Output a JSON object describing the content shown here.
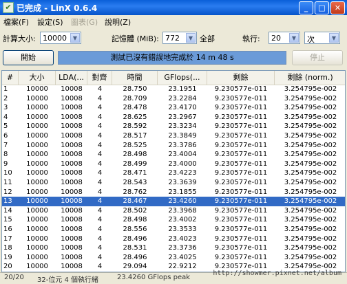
{
  "window": {
    "title": "已完成 - LinX 0.6.4",
    "minimize": "_",
    "maximize": "□",
    "close": "✕",
    "app_icon": "check-icon"
  },
  "menu": [
    {
      "label": "檔案(F)",
      "enabled": true
    },
    {
      "label": "設定(S)",
      "enabled": true
    },
    {
      "label": "圖表(G)",
      "enabled": false
    },
    {
      "label": "說明(Z)",
      "enabled": true
    }
  ],
  "controls": {
    "problem_size_label": "計算大小:",
    "problem_size_value": "10000",
    "memory_label": "記憶體 (MiB):",
    "memory_value": "772",
    "all_label": "全部",
    "run_label": "執行:",
    "run_value": "20",
    "run_unit": "次",
    "start_button": "開始",
    "stop_button": "停止",
    "status_text": "測試已沒有錯誤地完成於 14 m 48 s"
  },
  "table": {
    "columns": [
      "#",
      "大小",
      "LDA(...",
      "對齊",
      "時間",
      "GFlops(...",
      "剩餘",
      "剩餘 (norm.)"
    ],
    "selected_row": 13,
    "rows": [
      [
        "1",
        "10000",
        "10008",
        "4",
        "28.750",
        "23.1951",
        "9.230577e-011",
        "3.254795e-002"
      ],
      [
        "2",
        "10000",
        "10008",
        "4",
        "28.709",
        "23.2284",
        "9.230577e-011",
        "3.254795e-002"
      ],
      [
        "3",
        "10000",
        "10008",
        "4",
        "28.478",
        "23.4170",
        "9.230577e-011",
        "3.254795e-002"
      ],
      [
        "4",
        "10000",
        "10008",
        "4",
        "28.625",
        "23.2967",
        "9.230577e-011",
        "3.254795e-002"
      ],
      [
        "5",
        "10000",
        "10008",
        "4",
        "28.592",
        "23.3234",
        "9.230577e-011",
        "3.254795e-002"
      ],
      [
        "6",
        "10000",
        "10008",
        "4",
        "28.517",
        "23.3849",
        "9.230577e-011",
        "3.254795e-002"
      ],
      [
        "7",
        "10000",
        "10008",
        "4",
        "28.525",
        "23.3786",
        "9.230577e-011",
        "3.254795e-002"
      ],
      [
        "8",
        "10000",
        "10008",
        "4",
        "28.498",
        "23.4004",
        "9.230577e-011",
        "3.254795e-002"
      ],
      [
        "9",
        "10000",
        "10008",
        "4",
        "28.499",
        "23.4000",
        "9.230577e-011",
        "3.254795e-002"
      ],
      [
        "10",
        "10000",
        "10008",
        "4",
        "28.471",
        "23.4223",
        "9.230577e-011",
        "3.254795e-002"
      ],
      [
        "11",
        "10000",
        "10008",
        "4",
        "28.543",
        "23.3639",
        "9.230577e-011",
        "3.254795e-002"
      ],
      [
        "12",
        "10000",
        "10008",
        "4",
        "28.762",
        "23.1855",
        "9.230577e-011",
        "3.254795e-002"
      ],
      [
        "13",
        "10000",
        "10008",
        "4",
        "28.467",
        "23.4260",
        "9.230577e-011",
        "3.254795e-002"
      ],
      [
        "14",
        "10000",
        "10008",
        "4",
        "28.502",
        "23.3968",
        "9.230577e-011",
        "3.254795e-002"
      ],
      [
        "15",
        "10000",
        "10008",
        "4",
        "28.498",
        "23.4002",
        "9.230577e-011",
        "3.254795e-002"
      ],
      [
        "16",
        "10000",
        "10008",
        "4",
        "28.556",
        "23.3533",
        "9.230577e-011",
        "3.254795e-002"
      ],
      [
        "17",
        "10000",
        "10008",
        "4",
        "28.496",
        "23.4023",
        "9.230577e-011",
        "3.254795e-002"
      ],
      [
        "18",
        "10000",
        "10008",
        "4",
        "28.531",
        "23.3736",
        "9.230577e-011",
        "3.254795e-002"
      ],
      [
        "19",
        "10000",
        "10008",
        "4",
        "28.496",
        "23.4025",
        "9.230577e-011",
        "3.254795e-002"
      ],
      [
        "20",
        "10000",
        "10008",
        "4",
        "29.094",
        "22.9212",
        "9.230577e-011",
        "3.254795e-002"
      ]
    ]
  },
  "statusbar": {
    "progress": "20/20",
    "info": "32-位元 4 個執行緒",
    "peak": "23.4260 GFlops peak"
  },
  "watermark": "http://showmer.pixnet.net/album",
  "colors": {
    "titlebar": "#0a5fd8",
    "status_fill": "#6b9bd8",
    "selection": "#316ac5"
  }
}
